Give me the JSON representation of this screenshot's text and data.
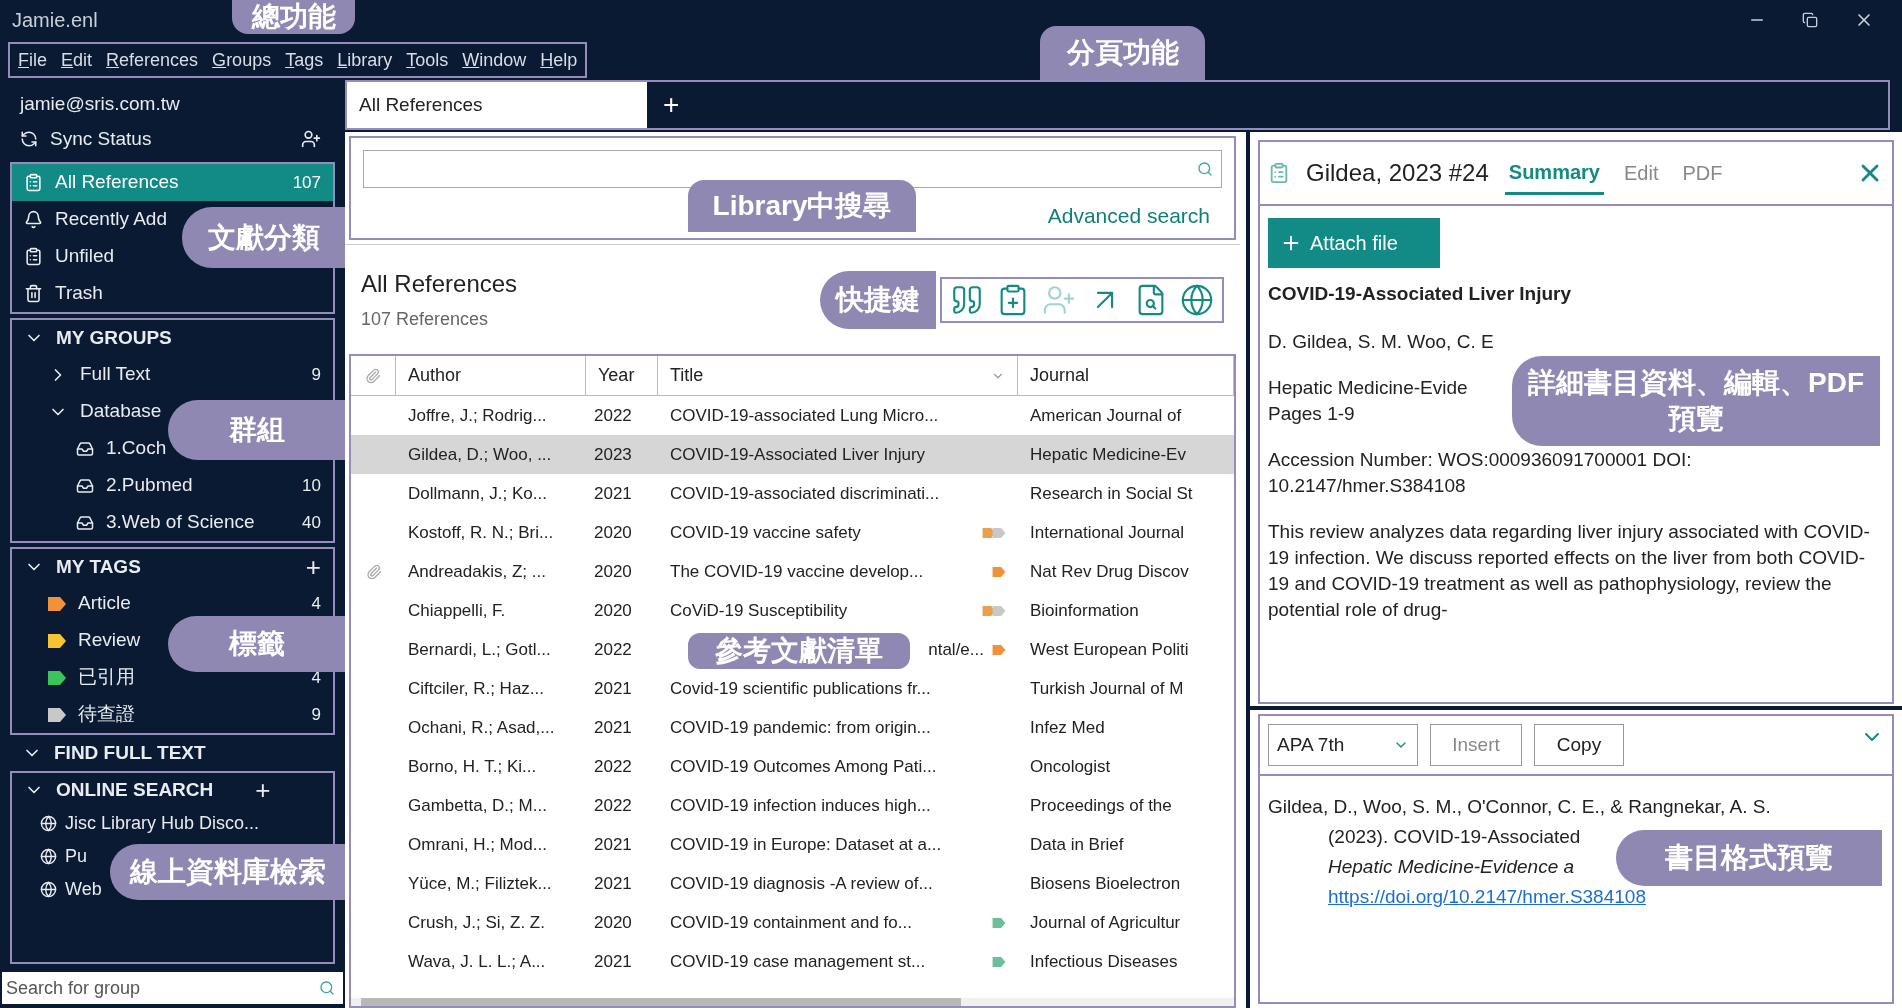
{
  "window": {
    "title": "Jamie.enl"
  },
  "menu": [
    "File",
    "Edit",
    "References",
    "Groups",
    "Tags",
    "Library",
    "Tools",
    "Window",
    "Help"
  ],
  "sidebar": {
    "account": "jamie@sris.com.tw",
    "sync": "Sync Status",
    "library": [
      {
        "kind": "all",
        "label": "All References",
        "count": "107",
        "selected": true
      },
      {
        "kind": "recent",
        "label": "Recently Add",
        "selected": false
      },
      {
        "kind": "unfiled",
        "label": "Unfiled",
        "selected": false
      },
      {
        "kind": "trash",
        "label": "Trash",
        "selected": false
      }
    ],
    "groups": {
      "title": "MY GROUPS",
      "expanded": true,
      "items": [
        {
          "label": "Full Text",
          "count": "9",
          "expanded": false
        },
        {
          "label": "Database",
          "expanded": true,
          "children": [
            {
              "label": "1.Coch"
            },
            {
              "label": "2.Pubmed",
              "count": "10"
            },
            {
              "label": "3.Web of Science",
              "count": "40"
            }
          ]
        }
      ]
    },
    "tags": {
      "title": "MY TAGS",
      "add": "+",
      "expanded": true,
      "items": [
        {
          "label": "Article",
          "count": "4",
          "color": "#f0923a"
        },
        {
          "label": "Review",
          "color": "#f5c431"
        },
        {
          "label": "已引用",
          "count": "4",
          "color": "#3cc45a"
        },
        {
          "label": "待查證",
          "count": "9",
          "color": "#c8c8c8"
        }
      ]
    },
    "find_full_text": {
      "title": "FIND FULL TEXT",
      "expanded": true
    },
    "online_search": {
      "title": "ONLINE SEARCH",
      "add": "+",
      "expanded": true,
      "items": [
        "Jisc Library Hub Disco...",
        "Pu",
        "Web"
      ]
    },
    "group_search": {
      "placeholder": "Search for group"
    }
  },
  "tabs": [
    {
      "label": "All References",
      "selected": true
    }
  ],
  "new_tab": "+",
  "search": {
    "advanced": "Advanced search"
  },
  "list": {
    "title": "All References",
    "count": "107 References"
  },
  "toolbar": [
    {
      "kind": "quote",
      "disabled": false
    },
    {
      "kind": "insert",
      "disabled": false
    },
    {
      "kind": "share",
      "disabled": true
    },
    {
      "kind": "export",
      "disabled": false
    },
    {
      "kind": "find",
      "disabled": false
    },
    {
      "kind": "online",
      "disabled": false
    }
  ],
  "table": {
    "columns": [
      "Author",
      "Year",
      "Title",
      "Journal"
    ],
    "rows": [
      {
        "author": "Joffre, J.; Rodrig...",
        "year": "2022",
        "title": "COVID-19-associated Lung Micro...",
        "journal": "American Journal of",
        "attachment": false,
        "selected": false,
        "tags": []
      },
      {
        "author": "Gildea, D.; Woo, ...",
        "year": "2023",
        "title": "COVID-19-Associated Liver Injury",
        "journal": "Hepatic Medicine-Ev",
        "attachment": false,
        "selected": true,
        "tags": []
      },
      {
        "author": "Dollmann, J.; Ko...",
        "year": "2021",
        "title": "COVID-19-associated discriminati...",
        "journal": "Research in Social St",
        "attachment": false,
        "selected": false,
        "tags": []
      },
      {
        "author": "Kostoff, R. N.; Bri...",
        "year": "2020",
        "title": "COVID-19 vaccine safety",
        "journal": "International Journal",
        "attachment": false,
        "selected": false,
        "tags": [
          {
            "color": "#e8a04a"
          },
          {
            "color": "#c8c8c8"
          }
        ]
      },
      {
        "author": "Andreadakis, Z; ...",
        "year": "2020",
        "title": "The COVID-19 vaccine develop...",
        "journal": "Nat Rev Drug Discov",
        "attachment": true,
        "selected": false,
        "tags": [
          {
            "color": "#f0923a"
          }
        ]
      },
      {
        "author": "Chiappelli, F.",
        "year": "2020",
        "title": "CoViD-19 Susceptibility",
        "journal": "Bioinformation",
        "attachment": false,
        "selected": false,
        "tags": [
          {
            "color": "#e8a04a"
          },
          {
            "color": "#c8c8c8"
          }
        ]
      },
      {
        "author": "Bernardi, L.; Gotl...",
        "year": "2022",
        "title": "ntal/e...",
        "title_partial": true,
        "journal": "West European Politi",
        "attachment": false,
        "selected": false,
        "tags": [
          {
            "color": "#f0923a"
          }
        ]
      },
      {
        "author": "Ciftciler, R.; Haz...",
        "year": "2021",
        "title": "Covid-19 scientific publications fr...",
        "journal": "Turkish Journal of M",
        "attachment": false,
        "selected": false,
        "tags": []
      },
      {
        "author": "Ochani, R.; Asad,...",
        "year": "2021",
        "title": "COVID-19 pandemic: from origin...",
        "journal": "Infez Med",
        "attachment": false,
        "selected": false,
        "tags": []
      },
      {
        "author": "Borno, H. T.; Ki...",
        "year": "2022",
        "title": "COVID-19 Outcomes Among Pati...",
        "journal": "Oncologist",
        "attachment": false,
        "selected": false,
        "tags": []
      },
      {
        "author": "Gambetta, D.; M...",
        "year": "2022",
        "title": "COVID-19 infection induces high...",
        "journal": "Proceedings of the",
        "attachment": false,
        "selected": false,
        "tags": []
      },
      {
        "author": "Omrani, H.; Mod...",
        "year": "2021",
        "title": "COVID-19 in Europe: Dataset at a...",
        "journal": "Data in Brief",
        "attachment": false,
        "selected": false,
        "tags": []
      },
      {
        "author": "Yüce, M.; Filiztek...",
        "year": "2021",
        "title": "COVID-19 diagnosis -A review of...",
        "journal": "Biosens Bioelectron",
        "attachment": false,
        "selected": false,
        "tags": []
      },
      {
        "author": "Crush, J.; Si, Z. Z.",
        "year": "2020",
        "title": "COVID-19 containment and fo...",
        "journal": "Journal of Agricultur",
        "attachment": false,
        "selected": false,
        "tags": [
          {
            "color": "#6dbf9c"
          }
        ]
      },
      {
        "author": "Wava, J. L. L.; A...",
        "year": "2021",
        "title": "COVID-19 case management st...",
        "journal": "Infectious Diseases",
        "attachment": false,
        "selected": false,
        "tags": [
          {
            "color": "#6dbf9c"
          }
        ]
      }
    ]
  },
  "reference": {
    "label": "Gildea, 2023 #24",
    "tabs": [
      {
        "label": "Summary",
        "selected": true
      },
      {
        "label": "Edit",
        "selected": false
      },
      {
        "label": "PDF",
        "selected": false
      }
    ],
    "attach": "Attach file",
    "title": "COVID-19-Associated Liver Injury",
    "paragraphs": [
      [
        "D. Gildea, S. M. Woo, C. E"
      ],
      [
        "Hepatic Medicine-Evide",
        "Pages 1-9"
      ],
      [
        "Accession Number: WOS:000936091700001 DOI:",
        "10.2147/hmer.S384108"
      ],
      [
        "This review analyzes data regarding liver injury associated with COVID-19 infection. We discuss reported effects on the liver from both COVID-19 and COVID-19 treatment as well as pathophysiology, review the potential role of drug-"
      ]
    ]
  },
  "citation": {
    "style": "APA 7th",
    "insert": {
      "label": "Insert",
      "disabled": true
    },
    "copy": "Copy",
    "lines": [
      {
        "kind": "plain",
        "text": "Gildea, D., Woo, S. M., O'Connor, C. E., & Rangnekar, A. S."
      },
      {
        "kind": "plain",
        "text": "(2023). COVID-19-Associated"
      },
      {
        "kind": "italic",
        "text": "Hepatic Medicine-Evidence a"
      },
      {
        "kind": "link",
        "text": "https://doi.org/10.2147/hmer.S384108"
      }
    ]
  },
  "annotations": [
    "總功能",
    "分頁功能",
    "文獻分類",
    "Library中搜尋",
    "快捷鍵",
    "群組",
    "標籤",
    "參考文獻清單",
    "詳細書目資料、編輯、PDF預覽",
    "線上資料庫檢索",
    "書目格式預覽"
  ]
}
